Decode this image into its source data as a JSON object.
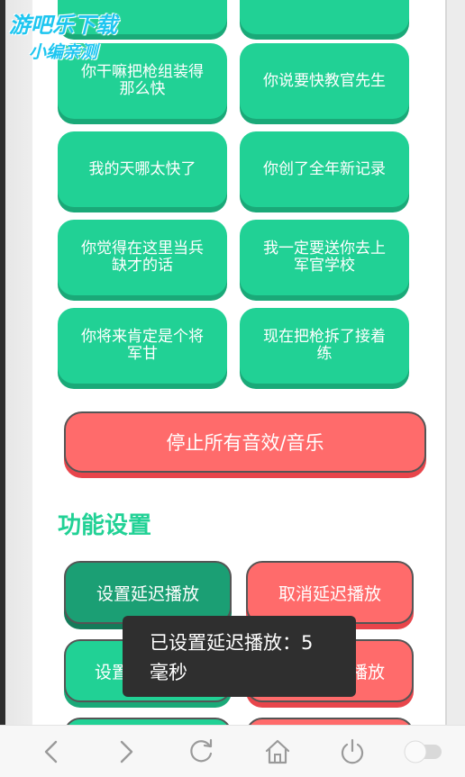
{
  "sound_buttons": [
    {
      "label": ""
    },
    {
      "label": ""
    },
    {
      "label": "你干嘛把枪组装得那么快"
    },
    {
      "label": "你说要快教官先生"
    },
    {
      "label": "我的天哪太快了"
    },
    {
      "label": "你创了全年新记录"
    },
    {
      "label": "你觉得在这里当兵缺才的话"
    },
    {
      "label": "我一定要送你去上军官学校"
    },
    {
      "label": "你将来肯定是个将军甘"
    },
    {
      "label": "现在把枪拆了接着练"
    }
  ],
  "stop_button": {
    "label": "停止所有音效/音乐"
  },
  "settings": {
    "title": "功能设置",
    "set_delay": "设置延迟播放",
    "cancel_delay": "取消延迟播放",
    "row2_left": "设置",
    "row2_right": "播放"
  },
  "toast": {
    "line1": "已设置延迟播放：5",
    "line2": "毫秒"
  },
  "watermark": {
    "line1": "游吧乐下载",
    "line2": "小编亲测"
  },
  "colors": {
    "green": "#21d195",
    "red": "#ff6b6b",
    "toast_bg": "#2f2f2f"
  },
  "navbar": {
    "icons": [
      "back-icon",
      "forward-icon",
      "refresh-icon",
      "home-icon",
      "power-icon",
      "toggle-icon"
    ]
  }
}
